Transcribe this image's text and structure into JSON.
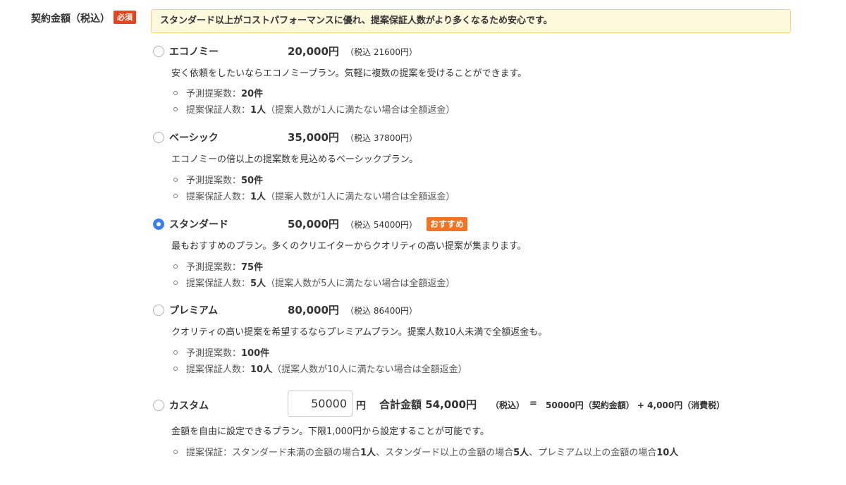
{
  "field": {
    "label": "契約金額（税込）",
    "required_badge": "必須"
  },
  "notice": "スタンダード以上がコストパフォーマンスに優れ、提案保証人数がより多くなるため安心です。",
  "colors": {
    "accent_blue": "#3a7ef2",
    "required_red": "#e8431f",
    "recommend_orange": "#f27320",
    "notice_bg": "#fef8dc"
  },
  "plans": [
    {
      "name": "エコノミー",
      "price": "20,000円",
      "tax": "（税込 21600円）",
      "checked": false,
      "description": "安く依頼をしたいならエコノミープラン。気軽に複数の提案を受けることができます。",
      "bullets": [
        {
          "label": "予測提案数：",
          "value": "20件",
          "note": ""
        },
        {
          "label": "提案保証人数：",
          "value": "1人",
          "note": "（提案人数が1人に満たない場合は全額返金）"
        }
      ]
    },
    {
      "name": "ベーシック",
      "price": "35,000円",
      "tax": "（税込 37800円）",
      "checked": false,
      "description": "エコノミーの倍以上の提案数を見込めるベーシックプラン。",
      "bullets": [
        {
          "label": "予測提案数：",
          "value": "50件",
          "note": ""
        },
        {
          "label": "提案保証人数：",
          "value": "1人",
          "note": "（提案人数が1人に満たない場合は全額返金）"
        }
      ]
    },
    {
      "name": "スタンダード",
      "price": "50,000円",
      "tax": "（税込 54000円）",
      "checked": true,
      "badge": "おすすめ",
      "description": "最もおすすめのプラン。多くのクリエイターからクオリティの高い提案が集まります。",
      "bullets": [
        {
          "label": "予測提案数：",
          "value": "75件",
          "note": ""
        },
        {
          "label": "提案保証人数：",
          "value": "5人",
          "note": "（提案人数が5人に満たない場合は全額返金）"
        }
      ]
    },
    {
      "name": "プレミアム",
      "price": "80,000円",
      "tax": "（税込 86400円）",
      "checked": false,
      "description": "クオリティの高い提案を希望するならプレミアムプラン。提案人数10人未満で全額返金も。",
      "bullets": [
        {
          "label": "予測提案数：",
          "value": "100件",
          "note": ""
        },
        {
          "label": "提案保証人数：",
          "value": "10人",
          "note": "（提案人数が10人に満たない場合は全額返金）"
        }
      ]
    }
  ],
  "custom": {
    "name": "カスタム",
    "checked": false,
    "input_value": "50000",
    "unit": "円",
    "total_label": "合計金額 54,000円",
    "total_tax_note": "（税込）",
    "equals": "=",
    "breakdown": "50000円（契約金額） + 4,000円（消費税）",
    "description": "金額を自由に設定できるプラン。下限1,000円から設定することが可能です。",
    "bullet": {
      "p1": "提案保証：スタンダード未満の金額の場合",
      "v1": "1人",
      "p2": "、スタンダード以上の金額の場合",
      "v2": "5人",
      "p3": "、プレミアム以上の金額の場合",
      "v3": "10人"
    }
  }
}
